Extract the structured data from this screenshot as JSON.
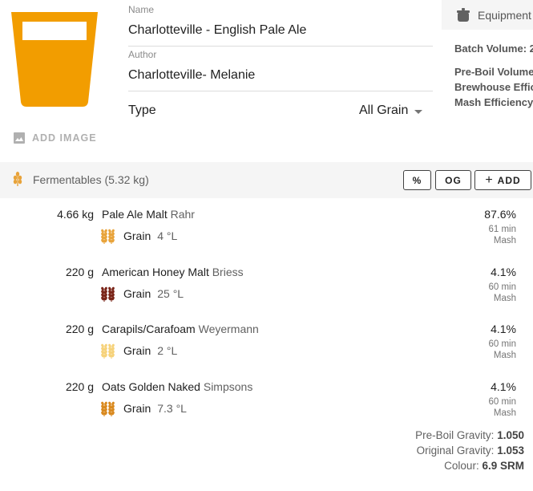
{
  "recipe": {
    "name_label": "Name",
    "name_value": "Charlotteville - English Pale Ale",
    "author_label": "Author",
    "author_value": "Charlotteville- Melanie",
    "type_label": "Type",
    "type_value": "All Grain",
    "add_image_label": "ADD IMAGE",
    "glass_color": "#F29D00"
  },
  "equipment": {
    "title": "Equipment",
    "batch_volume_label": "Batch Volume: 2",
    "preboil_volume_label": "Pre-Boil Volume",
    "brewhouse_eff_label": "Brewhouse Effic",
    "mash_eff_label": "Mash Efficiency"
  },
  "fermentables": {
    "title": "Fermentables (5.32 kg)",
    "buttons": {
      "percent": "%",
      "og": "OG",
      "add": "ADD",
      "add_symbol": "+"
    },
    "items": [
      {
        "amount": "4.66 kg",
        "name": "Pale Ale Malt",
        "maker": "Rahr",
        "type": "Grain",
        "lovibond": "4 °L",
        "percent": "87.6%",
        "time": "61 min",
        "use": "Mash",
        "color": "#E8A33A"
      },
      {
        "amount": "220 g",
        "name": "American Honey Malt",
        "maker": "Briess",
        "type": "Grain",
        "lovibond": "25 °L",
        "percent": "4.1%",
        "time": "60 min",
        "use": "Mash",
        "color": "#7A2418"
      },
      {
        "amount": "220 g",
        "name": "Carapils/Carafoam",
        "maker": "Weyermann",
        "type": "Grain",
        "lovibond": "2 °L",
        "percent": "4.1%",
        "time": "60 min",
        "use": "Mash",
        "color": "#F6D27A"
      },
      {
        "amount": "220 g",
        "name": "Oats Golden Naked",
        "maker": "Simpsons",
        "type": "Grain",
        "lovibond": "7.3 °L",
        "percent": "4.1%",
        "time": "60 min",
        "use": "Mash",
        "color": "#D9891E"
      }
    ],
    "summary": {
      "preboil_label": "Pre-Boil Gravity:",
      "preboil_value": "1.050",
      "og_label": "Original Gravity:",
      "og_value": "1.053",
      "colour_label": "Colour:",
      "colour_value": "6.9 SRM"
    }
  }
}
